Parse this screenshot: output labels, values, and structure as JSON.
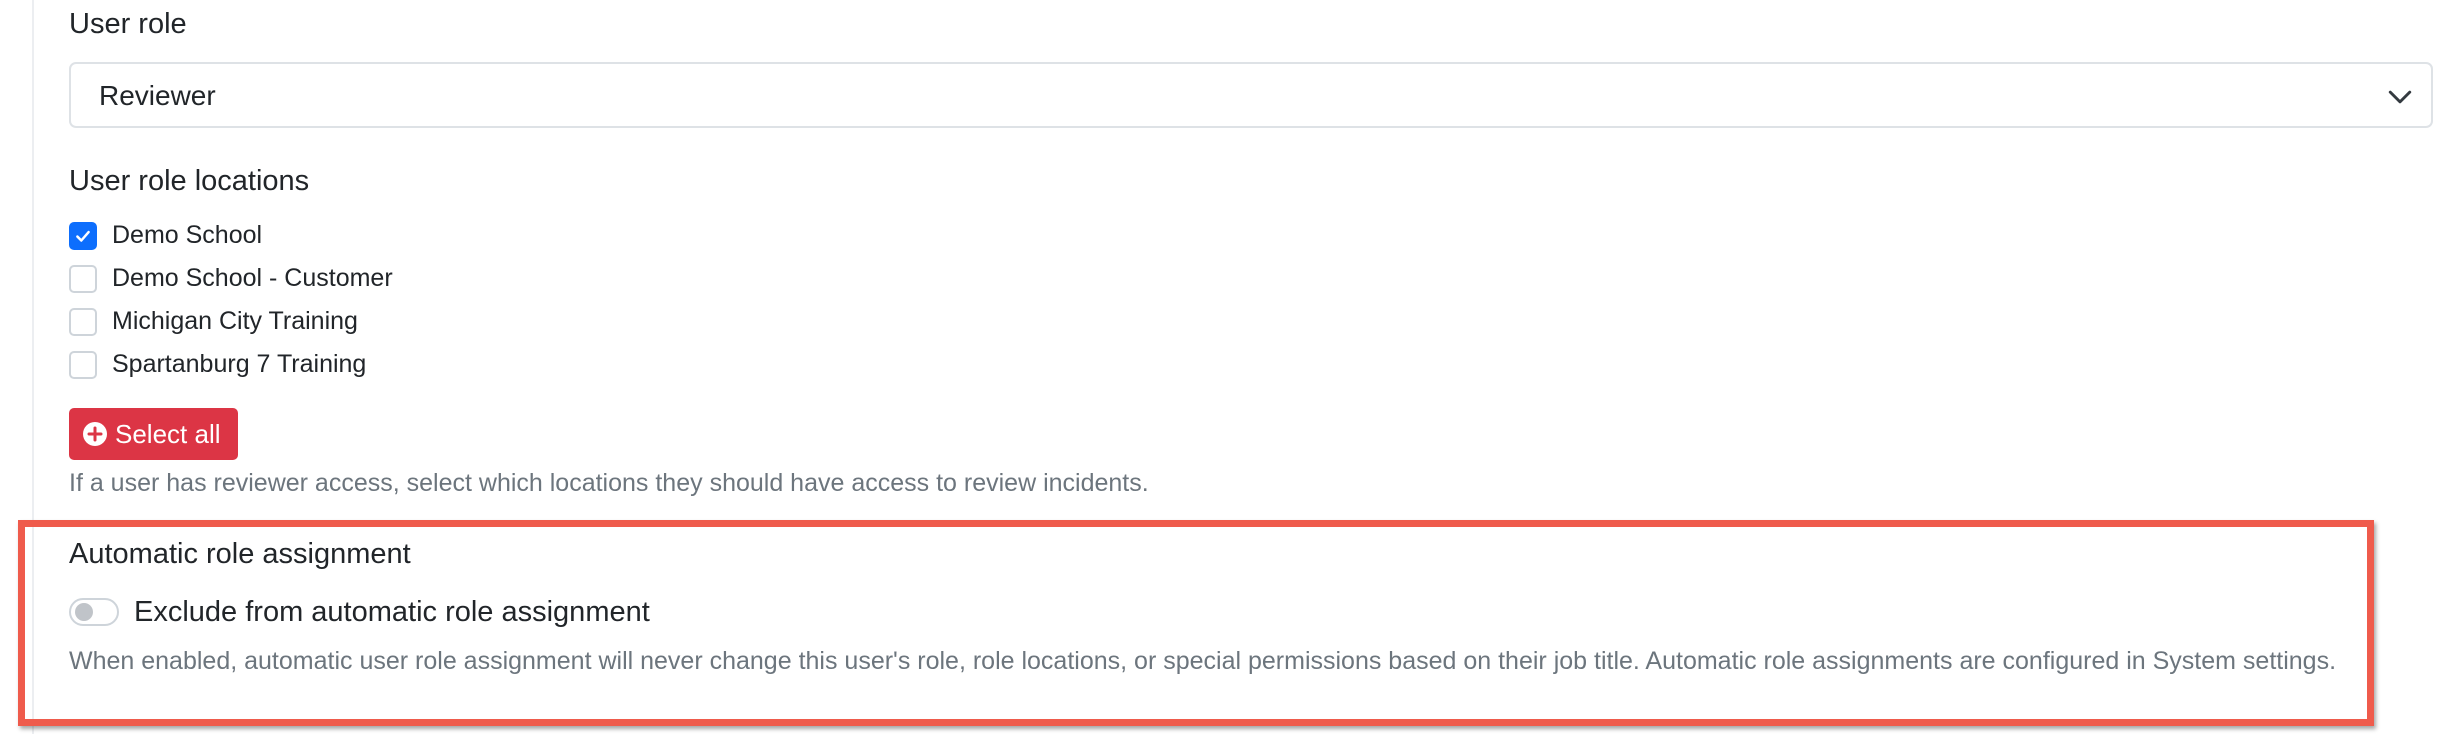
{
  "user_role": {
    "label": "User role",
    "selected": "Reviewer"
  },
  "locations": {
    "label": "User role locations",
    "items": [
      {
        "label": "Demo School",
        "checked": true
      },
      {
        "label": "Demo School - Customer",
        "checked": false
      },
      {
        "label": "Michigan City Training",
        "checked": false
      },
      {
        "label": "Spartanburg 7 Training",
        "checked": false
      }
    ],
    "select_all_label": "Select all",
    "help": "If a user has reviewer access, select which locations they should have access to review incidents."
  },
  "auto_role": {
    "label": "Automatic role assignment",
    "toggle_label": "Exclude from automatic role assignment",
    "toggle_on": false,
    "description": "When enabled, automatic user role assignment will never change this user's role, role locations, or special permissions based on their job title. Automatic role assignments are configured in System settings."
  },
  "colors": {
    "accent": "#0d6efd",
    "danger": "#dc3545",
    "highlight": "#ef5b4c"
  },
  "icons": {
    "select": "chevron-down-icon",
    "checkbox": "check-icon",
    "select_all": "plus-circle-icon"
  }
}
